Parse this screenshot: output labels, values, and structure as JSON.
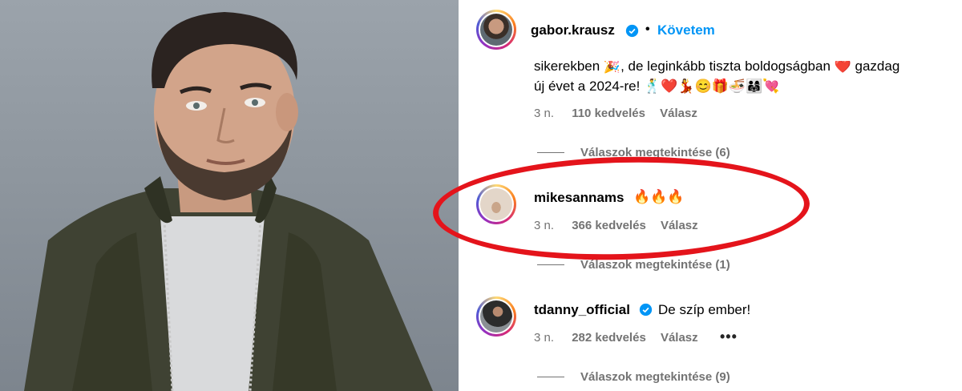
{
  "photo": {
    "subject": "man in olive bomber jacket"
  },
  "post_header": {
    "username": "gabor.krausz",
    "separator": "•",
    "follow_label": "Követem"
  },
  "caption": {
    "line1": "sikerekben 🎉, de leginkább tiszta boldogságban ❤️ gazdag",
    "line2": "új évet a 2024-re! 🕺❤️💃😊🎁🍜👨‍👩‍👧💘",
    "time": "3 n.",
    "likes": "110 kedvelés",
    "reply_label": "Válasz",
    "view_replies": "Válaszok megtekintése (6)"
  },
  "comments": [
    {
      "username": "mikesannams",
      "text": "🔥🔥🔥",
      "time": "3 n.",
      "likes": "366 kedvelés",
      "reply_label": "Válasz",
      "view_replies": "Válaszok megtekintése (1)"
    },
    {
      "username": "tdanny_official",
      "text": "De szíp ember!",
      "time": "3 n.",
      "likes": "282 kedvelés",
      "reply_label": "Válasz",
      "more": "•••",
      "view_replies": "Válaszok megtekintése (9)"
    }
  ],
  "colors": {
    "accent": "#0095f6",
    "highlight": "#e4141b",
    "muted": "#737373"
  }
}
